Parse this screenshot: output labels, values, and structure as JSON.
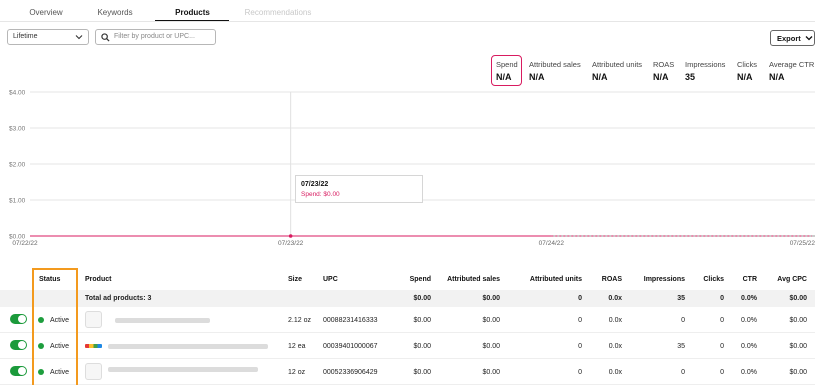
{
  "tabs": [
    {
      "label": "Overview"
    },
    {
      "label": "Keywords"
    },
    {
      "label": "Products"
    },
    {
      "label": "Recommendations"
    }
  ],
  "toolbar": {
    "date_range": "Lifetime",
    "search_placeholder": "Filter by product or UPC...",
    "export_label": "Export"
  },
  "metrics": [
    {
      "label": "Spend",
      "value": "N/A"
    },
    {
      "label": "Attributed sales",
      "value": "N/A"
    },
    {
      "label": "Attributed units",
      "value": "N/A"
    },
    {
      "label": "ROAS",
      "value": "N/A"
    },
    {
      "label": "Impressions",
      "value": "35"
    },
    {
      "label": "Clicks",
      "value": "N/A"
    },
    {
      "label": "Average CTR",
      "value": "N/A"
    }
  ],
  "chart_data": {
    "type": "line",
    "y_ticks": [
      "$4.00",
      "$3.00",
      "$2.00",
      "$1.00",
      "$0.00"
    ],
    "x_ticks": [
      "07/22/22",
      "07/23/22",
      "07/24/22",
      "07/25/22"
    ],
    "ylim": [
      0,
      4
    ],
    "series": [
      {
        "values": [
          0,
          0,
          0,
          0
        ],
        "color": "#d81b60"
      }
    ],
    "tooltip": {
      "date": "07/23/22",
      "text": "Spend: $0.00"
    }
  },
  "table": {
    "headers": {
      "status": "Status",
      "product": "Product",
      "size": "Size",
      "upc": "UPC",
      "spend": "Spend",
      "attributed_sales": "Attributed sales",
      "attributed_units": "Attributed units",
      "roas": "ROAS",
      "impressions": "Impressions",
      "clicks": "Clicks",
      "ctr": "CTR",
      "avg_cpc": "Avg CPC"
    },
    "total": {
      "label": "Total ad products: 3",
      "spend": "$0.00",
      "attributed_sales": "$0.00",
      "attributed_units": "0",
      "roas": "0.0x",
      "impressions": "35",
      "clicks": "0",
      "ctr": "0.0%",
      "avg_cpc": "$0.00"
    },
    "rows": [
      {
        "status": "Active",
        "size": "2.12 oz",
        "upc": "00088231416333",
        "spend": "$0.00",
        "attributed_sales": "$0.00",
        "attributed_units": "0",
        "roas": "0.0x",
        "impressions": "0",
        "clicks": "0",
        "ctr": "0.0%",
        "avg_cpc": "$0.00"
      },
      {
        "status": "Active",
        "size": "12 ea",
        "upc": "00039401000067",
        "spend": "$0.00",
        "attributed_sales": "$0.00",
        "attributed_units": "0",
        "roas": "0.0x",
        "impressions": "35",
        "clicks": "0",
        "ctr": "0.0%",
        "avg_cpc": "$0.00"
      },
      {
        "status": "Active",
        "size": "12 oz",
        "upc": "00052336906429",
        "spend": "$0.00",
        "attributed_sales": "$0.00",
        "attributed_units": "0",
        "roas": "0.0x",
        "impressions": "0",
        "clicks": "0",
        "ctr": "0.0%",
        "avg_cpc": "$0.00"
      }
    ]
  },
  "colors": {
    "accent": "#d81b60",
    "toggle": "#1b9a3b",
    "highlight": "#f39a1e"
  }
}
